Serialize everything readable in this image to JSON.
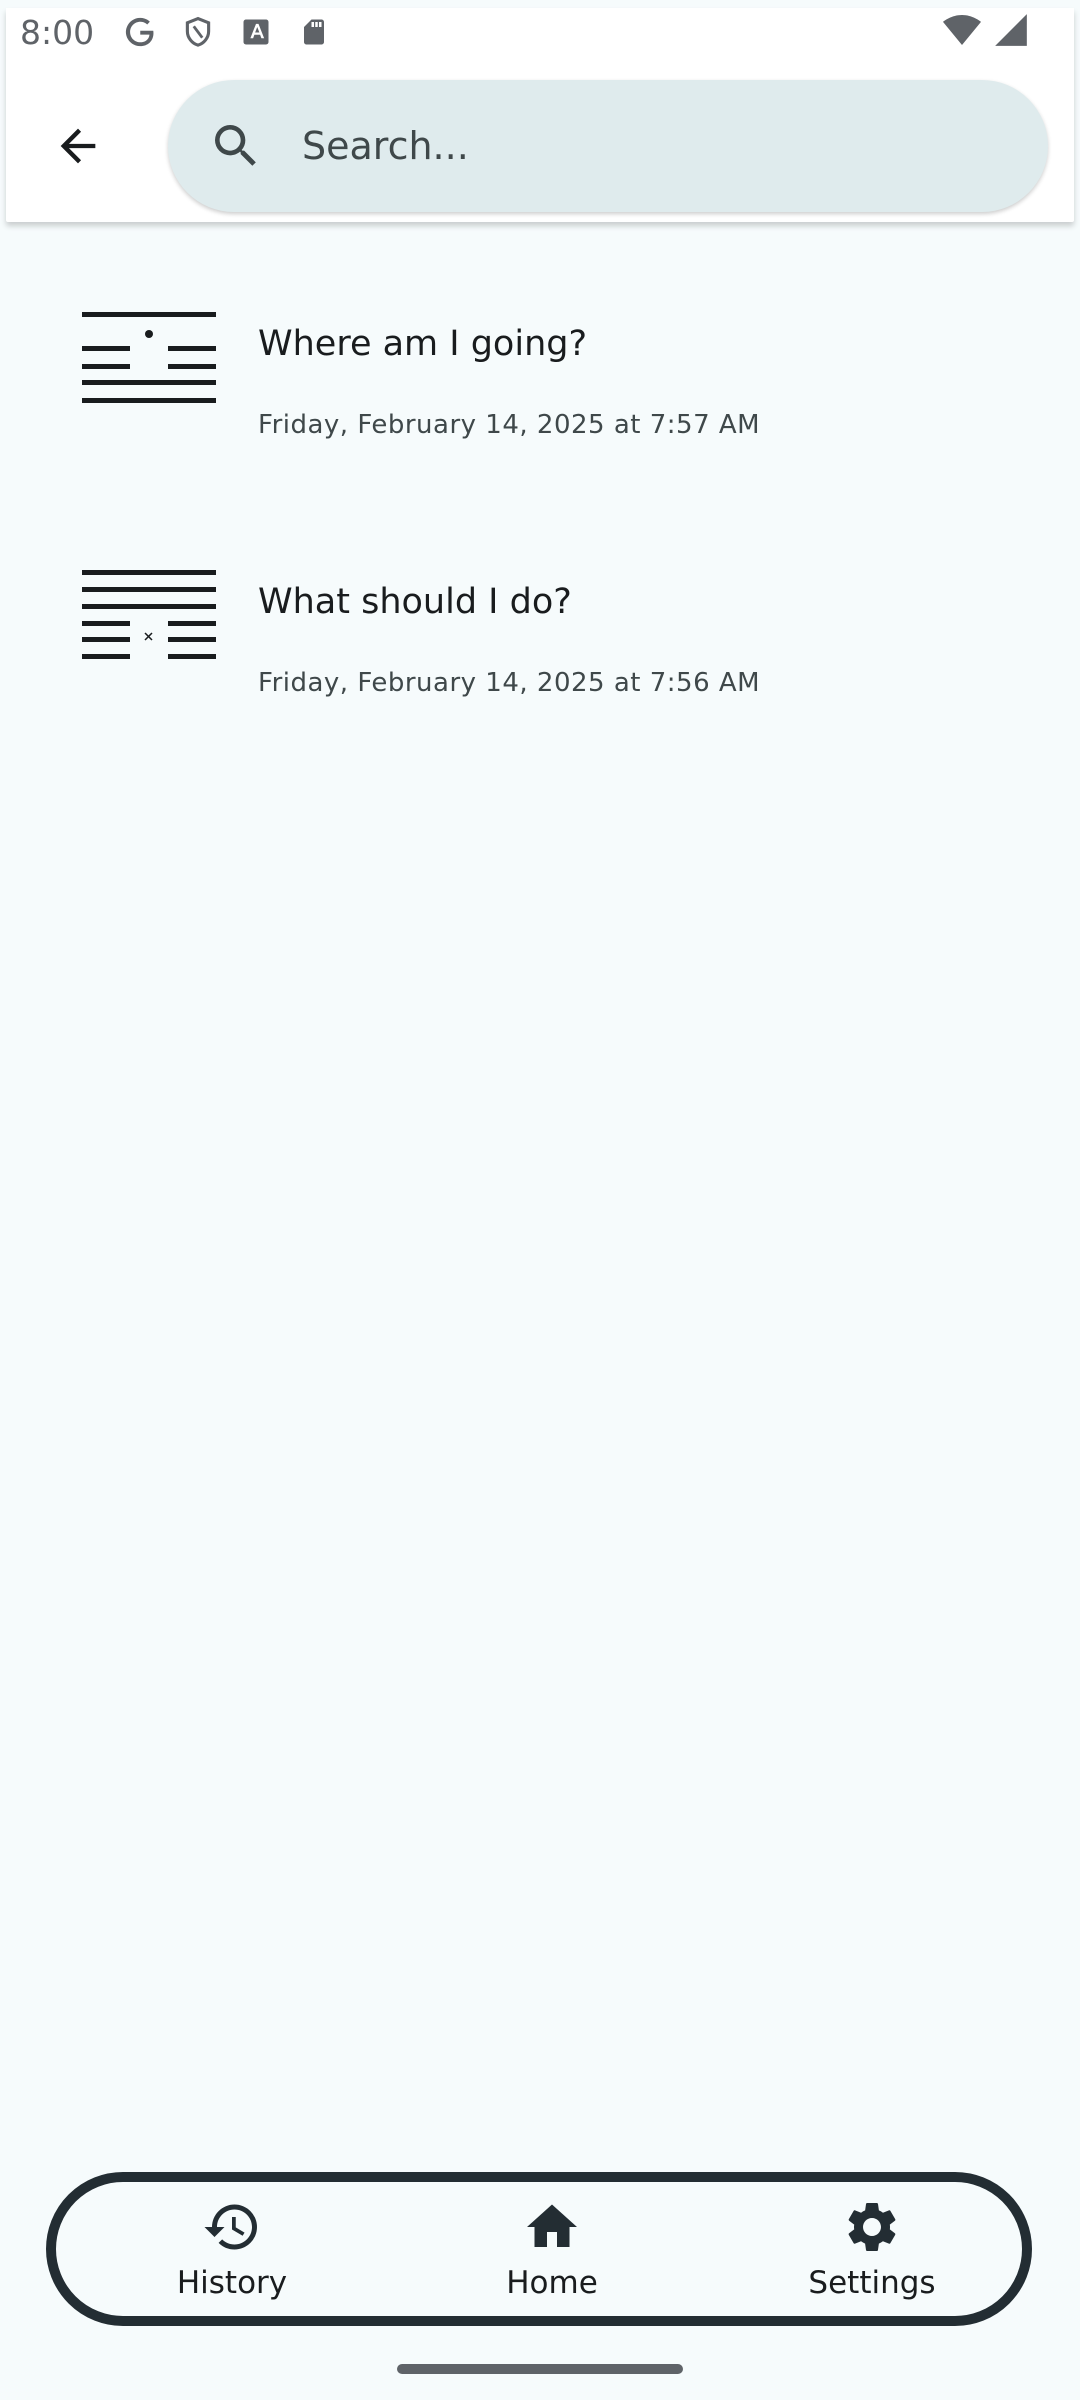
{
  "status_bar": {
    "time": "8:00",
    "left_icons": [
      "google-icon",
      "shield-icon",
      "font-icon",
      "sd-card-icon"
    ],
    "right_icons": [
      "wifi-icon",
      "cellular-signal-icon"
    ]
  },
  "app_bar": {
    "back_icon": "arrow-back-icon",
    "search_icon": "search-icon",
    "search_placeholder": "Search...",
    "search_value": ""
  },
  "history": {
    "items": [
      {
        "title": "Where am I going?",
        "date": "Friday, February 14, 2025 at 7:57 AM",
        "hexagram_icon": "hexagram-icon",
        "lines": [
          "yang",
          "yin",
          "yin",
          "yang"
        ],
        "marks": [
          {
            "line": 1,
            "mark": "dot"
          }
        ]
      },
      {
        "title": "What should I do?",
        "date": "Friday, February 14, 2025 at 7:56 AM",
        "hexagram_icon": "hexagram-icon",
        "lines": [
          "yang",
          "yang",
          "yang",
          "yin",
          "yin"
        ],
        "marks": [
          {
            "line": 4,
            "mark": "x"
          }
        ]
      }
    ]
  },
  "bottom_nav": {
    "items": [
      {
        "label": "History",
        "icon": "history-icon"
      },
      {
        "label": "Home",
        "icon": "home-icon"
      },
      {
        "label": "Settings",
        "icon": "gear-icon"
      }
    ]
  },
  "colors": {
    "background": "#f6fbfc",
    "search_fill": "#dfebed",
    "nav_border": "#232d33",
    "text_primary": "#191c1e"
  }
}
